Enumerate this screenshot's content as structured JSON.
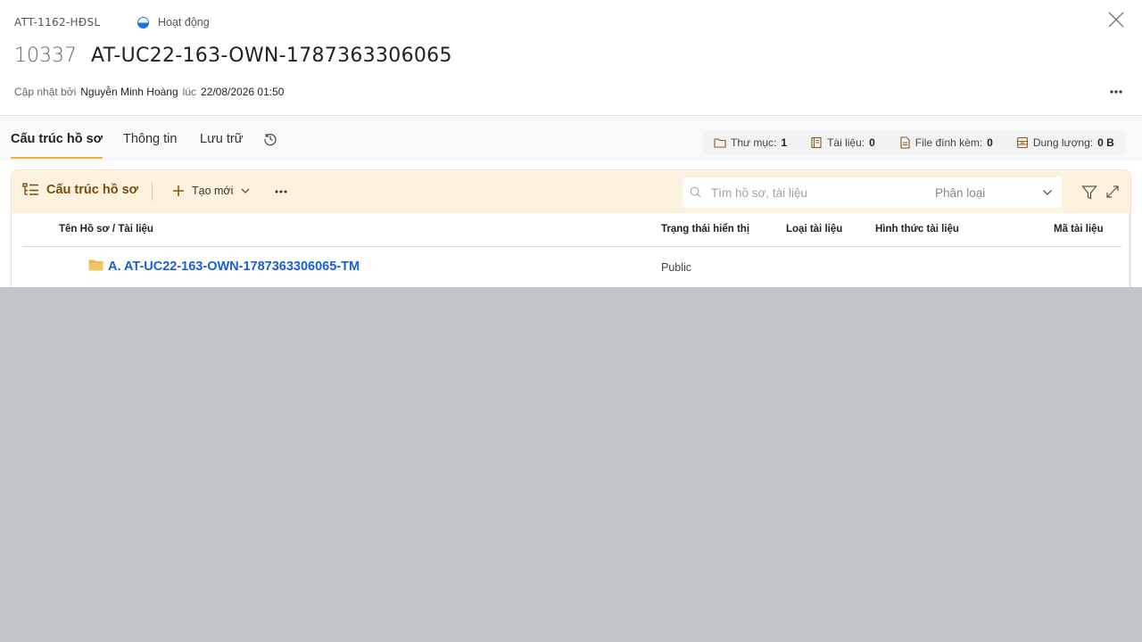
{
  "header": {
    "code": "ATT-1162-HĐSL",
    "status": "Hoạt động",
    "record_number": "10337",
    "record_name": "AT-UC22-163-OWN-1787363306065",
    "updated_by_label": "Cập nhật bởi",
    "updated_by": "Nguyễn Minh Hoàng",
    "at_label": "lúc",
    "updated_at": "22/08/2026 01:50"
  },
  "tabs": [
    {
      "label": "Cấu trúc hồ sơ",
      "active": true
    },
    {
      "label": "Thông tin",
      "active": false
    },
    {
      "label": "Lưu trữ",
      "active": false
    }
  ],
  "stats": {
    "folders_label": "Thư mục:",
    "folders_value": "1",
    "docs_label": "Tài liệu:",
    "docs_value": "0",
    "attachments_label": "File đính kèm:",
    "attachments_value": "0",
    "size_label": "Dung lượng:",
    "size_value": "0 B"
  },
  "toolbar": {
    "title": "Cấu trúc hồ sơ",
    "new_label": "Tạo mới",
    "search_placeholder": "Tìm hồ sơ, tài liệu",
    "classify_label": "Phân loại"
  },
  "table": {
    "columns": [
      "Tên Hồ sơ / Tài liệu",
      "Trạng thái hiển thị",
      "Loại tài liệu",
      "Hình thức tài liệu",
      "Mã tài liệu"
    ],
    "rows": [
      {
        "name": "A. AT-UC22-163-OWN-1787363306065-TM",
        "status": "Public",
        "type": "",
        "form": "",
        "code": ""
      }
    ]
  },
  "colors": {
    "accent": "#f2b02c",
    "link": "#1a5fd0",
    "toolbar_bg": "#fcf2dd",
    "overlay": "#c2c5c9"
  },
  "icons": [
    "status-half-circle-icon",
    "close-icon",
    "more-horizontal-icon",
    "history-refresh-icon",
    "folder-outline-icon",
    "book-icon",
    "file-icon",
    "storage-icon",
    "tree-list-icon",
    "plus-icon",
    "chevron-down-icon",
    "search-icon",
    "filter-icon",
    "expand-icon",
    "folder-filled-icon"
  ]
}
